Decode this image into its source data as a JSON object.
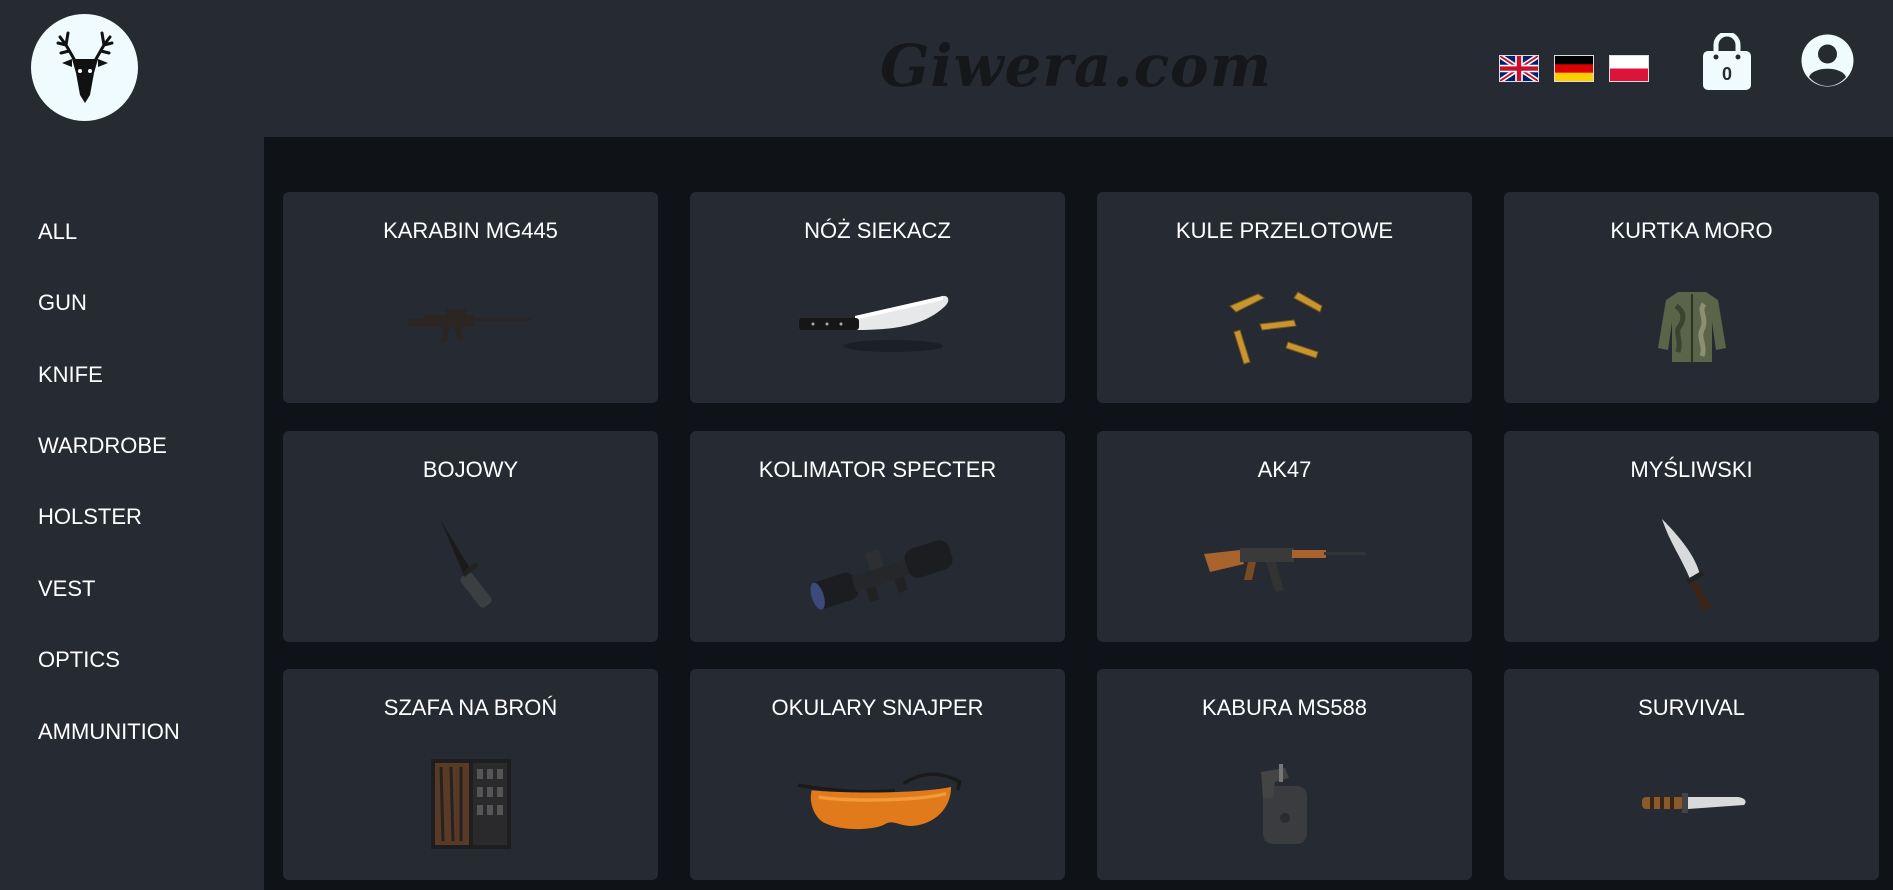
{
  "header": {
    "brand": "Giwera.com",
    "cart_count": "0",
    "flags": [
      "english-flag",
      "german-flag",
      "polish-flag"
    ]
  },
  "sidebar": {
    "items": [
      {
        "label": "ALL"
      },
      {
        "label": "GUN"
      },
      {
        "label": "KNIFE"
      },
      {
        "label": "WARDROBE"
      },
      {
        "label": "HOLSTER"
      },
      {
        "label": "VEST"
      },
      {
        "label": "OPTICS"
      },
      {
        "label": "AMMUNITION"
      }
    ]
  },
  "products": [
    {
      "title": "KARABIN MG445",
      "icon": "rifle-image"
    },
    {
      "title": "NÓŻ SIEKACZ",
      "icon": "chef-knife-image"
    },
    {
      "title": "KULE PRZELOTOWE",
      "icon": "bullets-image"
    },
    {
      "title": "KURTKA MORO",
      "icon": "camo-jacket-image"
    },
    {
      "title": "BOJOWY",
      "icon": "combat-knife-image"
    },
    {
      "title": "KOLIMATOR SPECTER",
      "icon": "scope-image"
    },
    {
      "title": "AK47",
      "icon": "ak47-image"
    },
    {
      "title": "MYŚLIWSKI",
      "icon": "hunting-knife-image"
    },
    {
      "title": "SZAFA NA BROŃ",
      "icon": "gun-safe-image"
    },
    {
      "title": "OKULARY SNAJPER",
      "icon": "shooting-glasses-image"
    },
    {
      "title": "KABURA MS588",
      "icon": "holster-image"
    },
    {
      "title": "SURVIVAL",
      "icon": "survival-knife-image"
    }
  ],
  "colors": {
    "header_bg": "#262a33",
    "main_bg": "#0f1317",
    "card_bg": "#262a33",
    "text": "#ffffff",
    "logo_bg": "#f0fbff"
  }
}
